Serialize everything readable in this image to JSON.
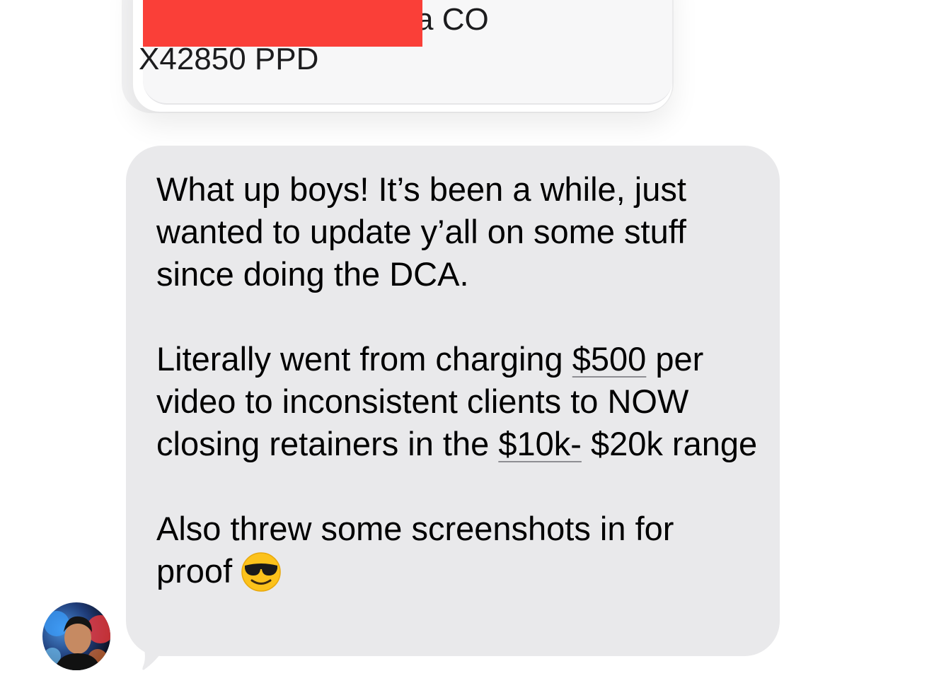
{
  "previous_message": {
    "line1_suffix": "a CO",
    "line2": "X42850 PPD"
  },
  "message": {
    "para1": "What up boys! It’s been a while, just wanted to update y’all on some stuff since doing the DCA.",
    "para2_part1": "Literally went from charging ",
    "para2_link1": "$500",
    "para2_part2": " per video to inconsistent clients to NOW closing retainers in the ",
    "para2_link2": "$10k-",
    "para2_part3": " $20k range",
    "para3": "Also threw some screenshots in for proof",
    "emoji": "smiling-face-with-sunglasses"
  },
  "colors": {
    "bubble_bg": "#e9e9eb",
    "redaction": "#fa3f38",
    "text": "#000000"
  }
}
